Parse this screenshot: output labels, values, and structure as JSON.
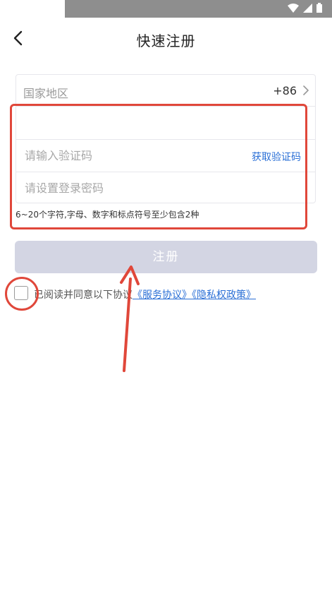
{
  "header": {
    "title": "快速注册"
  },
  "form": {
    "country_label": "国家地区",
    "country_code": "+86",
    "phone_placeholder": "",
    "code_placeholder": "请输入验证码",
    "get_code_label": "获取验证码",
    "password_placeholder": "请设置登录密码",
    "password_hint": "6~20个字符,字母、数字和标点符号至少包含2种"
  },
  "register_button": {
    "label": "注册"
  },
  "agreement": {
    "text": "已阅读并同意以下协议",
    "service_link": "《服务协议》",
    "privacy_link": "《隐私权政策》",
    "checked": false
  },
  "colors": {
    "accent": "#2a6fd6",
    "button_disabled": "#d3d5e3",
    "annotation": "#e0473a"
  }
}
